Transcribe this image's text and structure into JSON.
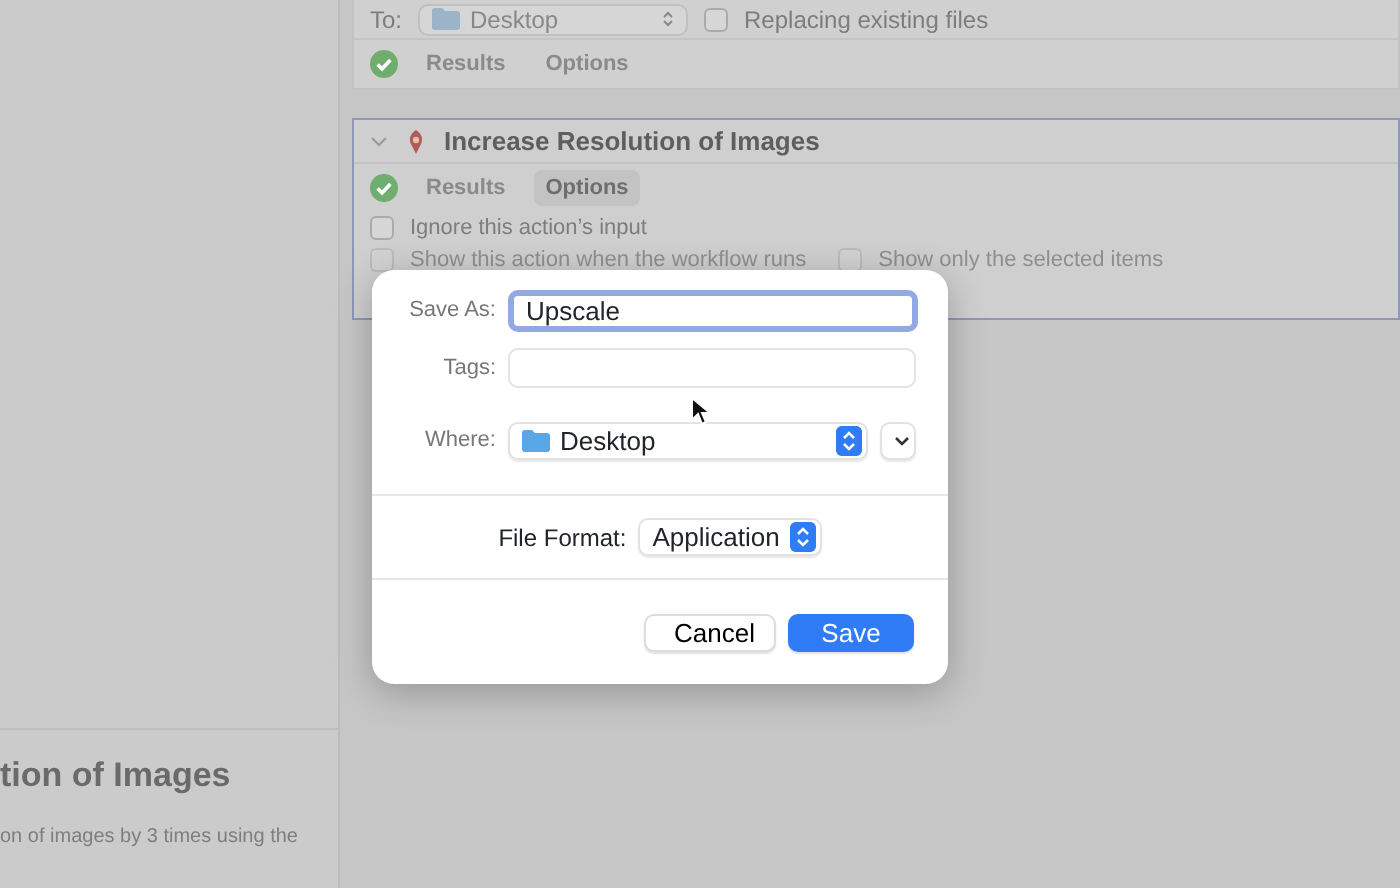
{
  "sidebar": {
    "title": "tion of Images",
    "description": "on of images by 3 times using the"
  },
  "previous_action": {
    "to_label": "To:",
    "destination": "Desktop",
    "replace": {
      "label": "Replacing existing files",
      "checked": false
    },
    "succeeded": true,
    "tabs": [
      {
        "label": "Results",
        "selected": false
      },
      {
        "label": "Options",
        "selected": false
      }
    ]
  },
  "current_action": {
    "title": "Increase Resolution of Images",
    "expanded": true,
    "succeeded": true,
    "tabs": [
      {
        "label": "Results",
        "selected": false
      },
      {
        "label": "Options",
        "selected": true
      }
    ],
    "options": [
      {
        "label": "Ignore this action’s input",
        "checked": false
      },
      {
        "label": "Show this action when the workflow runs",
        "checked": false
      },
      {
        "label": "Show only the selected items",
        "checked": false
      }
    ]
  },
  "dialog": {
    "save_as": {
      "label": "Save As:",
      "value": "Upscale"
    },
    "tags": {
      "label": "Tags:"
    },
    "where": {
      "label": "Where:",
      "value": "Desktop"
    },
    "file_format": {
      "label": "File Format:",
      "value": "Application"
    },
    "buttons": [
      {
        "label": "Cancel",
        "kind": "secondary"
      },
      {
        "label": "Save",
        "kind": "primary"
      }
    ]
  }
}
